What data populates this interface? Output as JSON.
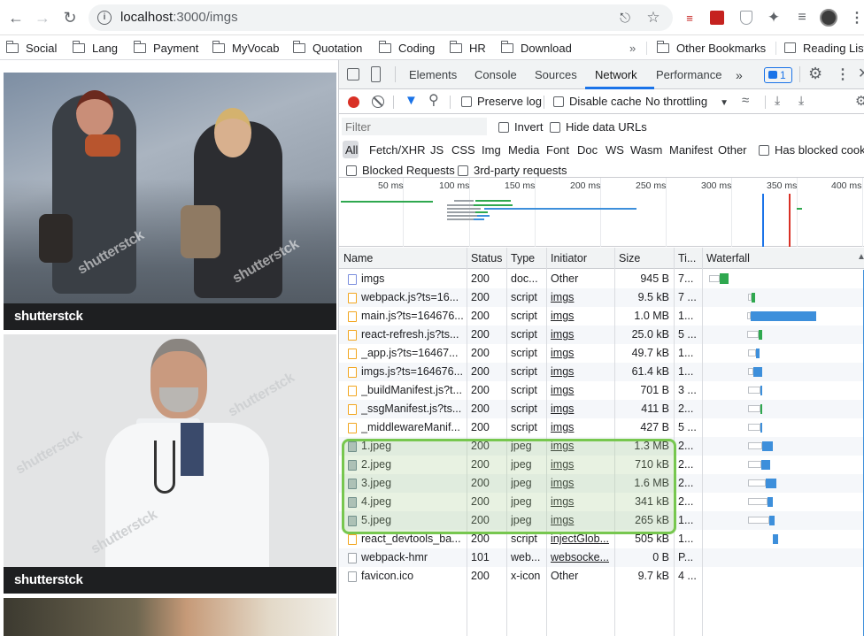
{
  "browser": {
    "url_host": "localhost",
    "url_path": ":3000/imgs",
    "bookmarks": [
      "Social",
      "Lang",
      "Payment",
      "MyVocab",
      "Quotation",
      "Coding",
      "HR",
      "Download"
    ],
    "more": "»",
    "other_bookmarks": "Other Bookmarks",
    "reading_list": "Reading List"
  },
  "page": {
    "watermark": "shutterstck",
    "brand": "shutterstck"
  },
  "devtools": {
    "tabs": [
      "Elements",
      "Console",
      "Sources",
      "Network",
      "Performance"
    ],
    "active_tab": "Network",
    "more_tabs": "»",
    "issues_count": "1",
    "preserve_log": "Preserve log",
    "disable_cache": "Disable cache",
    "throttling": "No throttling",
    "filter_placeholder": "Filter",
    "invert": "Invert",
    "hide_data_urls": "Hide data URLs",
    "types": [
      "All",
      "Fetch/XHR",
      "JS",
      "CSS",
      "Img",
      "Media",
      "Font",
      "Doc",
      "WS",
      "Wasm",
      "Manifest",
      "Other"
    ],
    "has_blocked_cookies": "Has blocked cookies",
    "blocked_requests": "Blocked Requests",
    "third_party": "3rd-party requests",
    "timeline_ticks": [
      "50 ms",
      "100 ms",
      "150 ms",
      "200 ms",
      "250 ms",
      "300 ms",
      "350 ms",
      "400 ms"
    ],
    "columns": [
      "Name",
      "Status",
      "Type",
      "Initiator",
      "Size",
      "Ti...",
      "Waterfall"
    ],
    "rows": [
      {
        "name": "imgs",
        "status": "200",
        "type": "doc...",
        "initiator": "Other",
        "size": "945 B",
        "time": "7...",
        "kind": "doc",
        "link": false
      },
      {
        "name": "webpack.js?ts=16...",
        "status": "200",
        "type": "script",
        "initiator": "imgs",
        "size": "9.5 kB",
        "time": "7 ...",
        "kind": "js",
        "link": true
      },
      {
        "name": "main.js?ts=164676...",
        "status": "200",
        "type": "script",
        "initiator": "imgs",
        "size": "1.0 MB",
        "time": "1...",
        "kind": "js",
        "link": true
      },
      {
        "name": "react-refresh.js?ts...",
        "status": "200",
        "type": "script",
        "initiator": "imgs",
        "size": "25.0 kB",
        "time": "5 ...",
        "kind": "js",
        "link": true
      },
      {
        "name": "_app.js?ts=16467...",
        "status": "200",
        "type": "script",
        "initiator": "imgs",
        "size": "49.7 kB",
        "time": "1...",
        "kind": "js",
        "link": true
      },
      {
        "name": "imgs.js?ts=164676...",
        "status": "200",
        "type": "script",
        "initiator": "imgs",
        "size": "61.4 kB",
        "time": "1...",
        "kind": "js",
        "link": true
      },
      {
        "name": "_buildManifest.js?t...",
        "status": "200",
        "type": "script",
        "initiator": "imgs",
        "size": "701 B",
        "time": "3 ...",
        "kind": "js",
        "link": true
      },
      {
        "name": "_ssgManifest.js?ts...",
        "status": "200",
        "type": "script",
        "initiator": "imgs",
        "size": "411 B",
        "time": "2...",
        "kind": "js",
        "link": true
      },
      {
        "name": "_middlewareManif...",
        "status": "200",
        "type": "script",
        "initiator": "imgs",
        "size": "427 B",
        "time": "5 ...",
        "kind": "js",
        "link": true
      },
      {
        "name": "1.jpeg",
        "status": "200",
        "type": "jpeg",
        "initiator": "imgs",
        "size": "1.3 MB",
        "time": "2...",
        "kind": "img",
        "link": true
      },
      {
        "name": "2.jpeg",
        "status": "200",
        "type": "jpeg",
        "initiator": "imgs",
        "size": "710 kB",
        "time": "2...",
        "kind": "img",
        "link": true
      },
      {
        "name": "3.jpeg",
        "status": "200",
        "type": "jpeg",
        "initiator": "imgs",
        "size": "1.6 MB",
        "time": "2...",
        "kind": "img",
        "link": true
      },
      {
        "name": "4.jpeg",
        "status": "200",
        "type": "jpeg",
        "initiator": "imgs",
        "size": "341 kB",
        "time": "2...",
        "kind": "img",
        "link": true
      },
      {
        "name": "5.jpeg",
        "status": "200",
        "type": "jpeg",
        "initiator": "imgs",
        "size": "265 kB",
        "time": "1...",
        "kind": "img",
        "link": true
      },
      {
        "name": "react_devtools_ba...",
        "status": "200",
        "type": "script",
        "initiator": "injectGlob...",
        "size": "505 kB",
        "time": "1...",
        "kind": "js",
        "link": true
      },
      {
        "name": "webpack-hmr",
        "status": "101",
        "type": "web...",
        "initiator": "websocke...",
        "size": "0 B",
        "time": "P...",
        "kind": "plain",
        "link": true
      },
      {
        "name": "favicon.ico",
        "status": "200",
        "type": "x-icon",
        "initiator": "Other",
        "size": "9.7 kB",
        "time": "4 ...",
        "kind": "plain",
        "link": false
      }
    ]
  },
  "colors": {
    "highlight_border": "#77c74f",
    "highlight_fill": "#dfe8d8",
    "waterfall_green": "#2fa84f",
    "waterfall_blue": "#3d8fdb",
    "record_red": "#d93025",
    "accent_blue": "#1a73e8"
  }
}
